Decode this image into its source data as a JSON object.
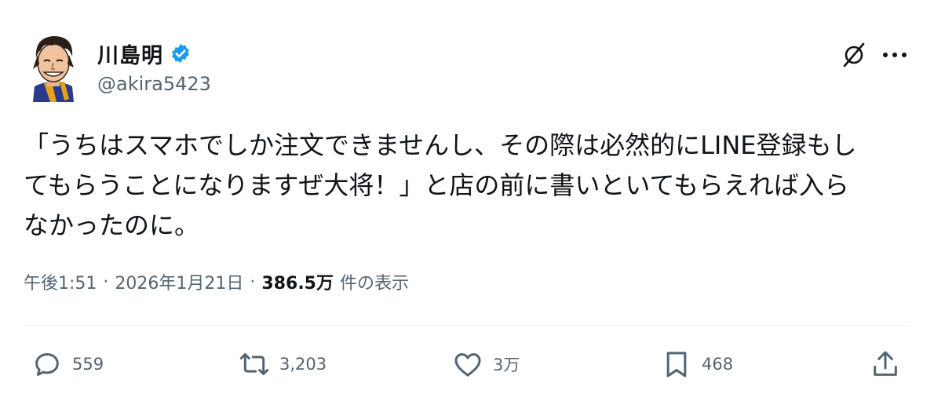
{
  "author": {
    "display_name": "川島明",
    "handle": "@akira5423",
    "verified": true,
    "avatar_icon": "caricature-avatar"
  },
  "header_actions": {
    "grok_icon": "grok-slash-icon",
    "more_icon": "more-horizontal-icon"
  },
  "tweet": {
    "lines": [
      "「うちはスマホでしか注文できませんし、その際は必然的にLINE登録もし",
      "てもらうことになりますぜ大将！」と店の前に書いといてもらえれば入ら",
      "なかったのに。"
    ]
  },
  "meta": {
    "time": "午後1:51",
    "separator": "·",
    "date": "2026年1月21日",
    "views": "386.5万",
    "views_label": "件の表示"
  },
  "actions": {
    "reply_count": "559",
    "retweet_count": "3,203",
    "like_count": "3万",
    "bookmark_count": "468"
  },
  "colors": {
    "text_primary": "#0f1419",
    "text_secondary": "#536471",
    "verified_blue": "#1d9bf0",
    "divider": "#eff3f4"
  }
}
